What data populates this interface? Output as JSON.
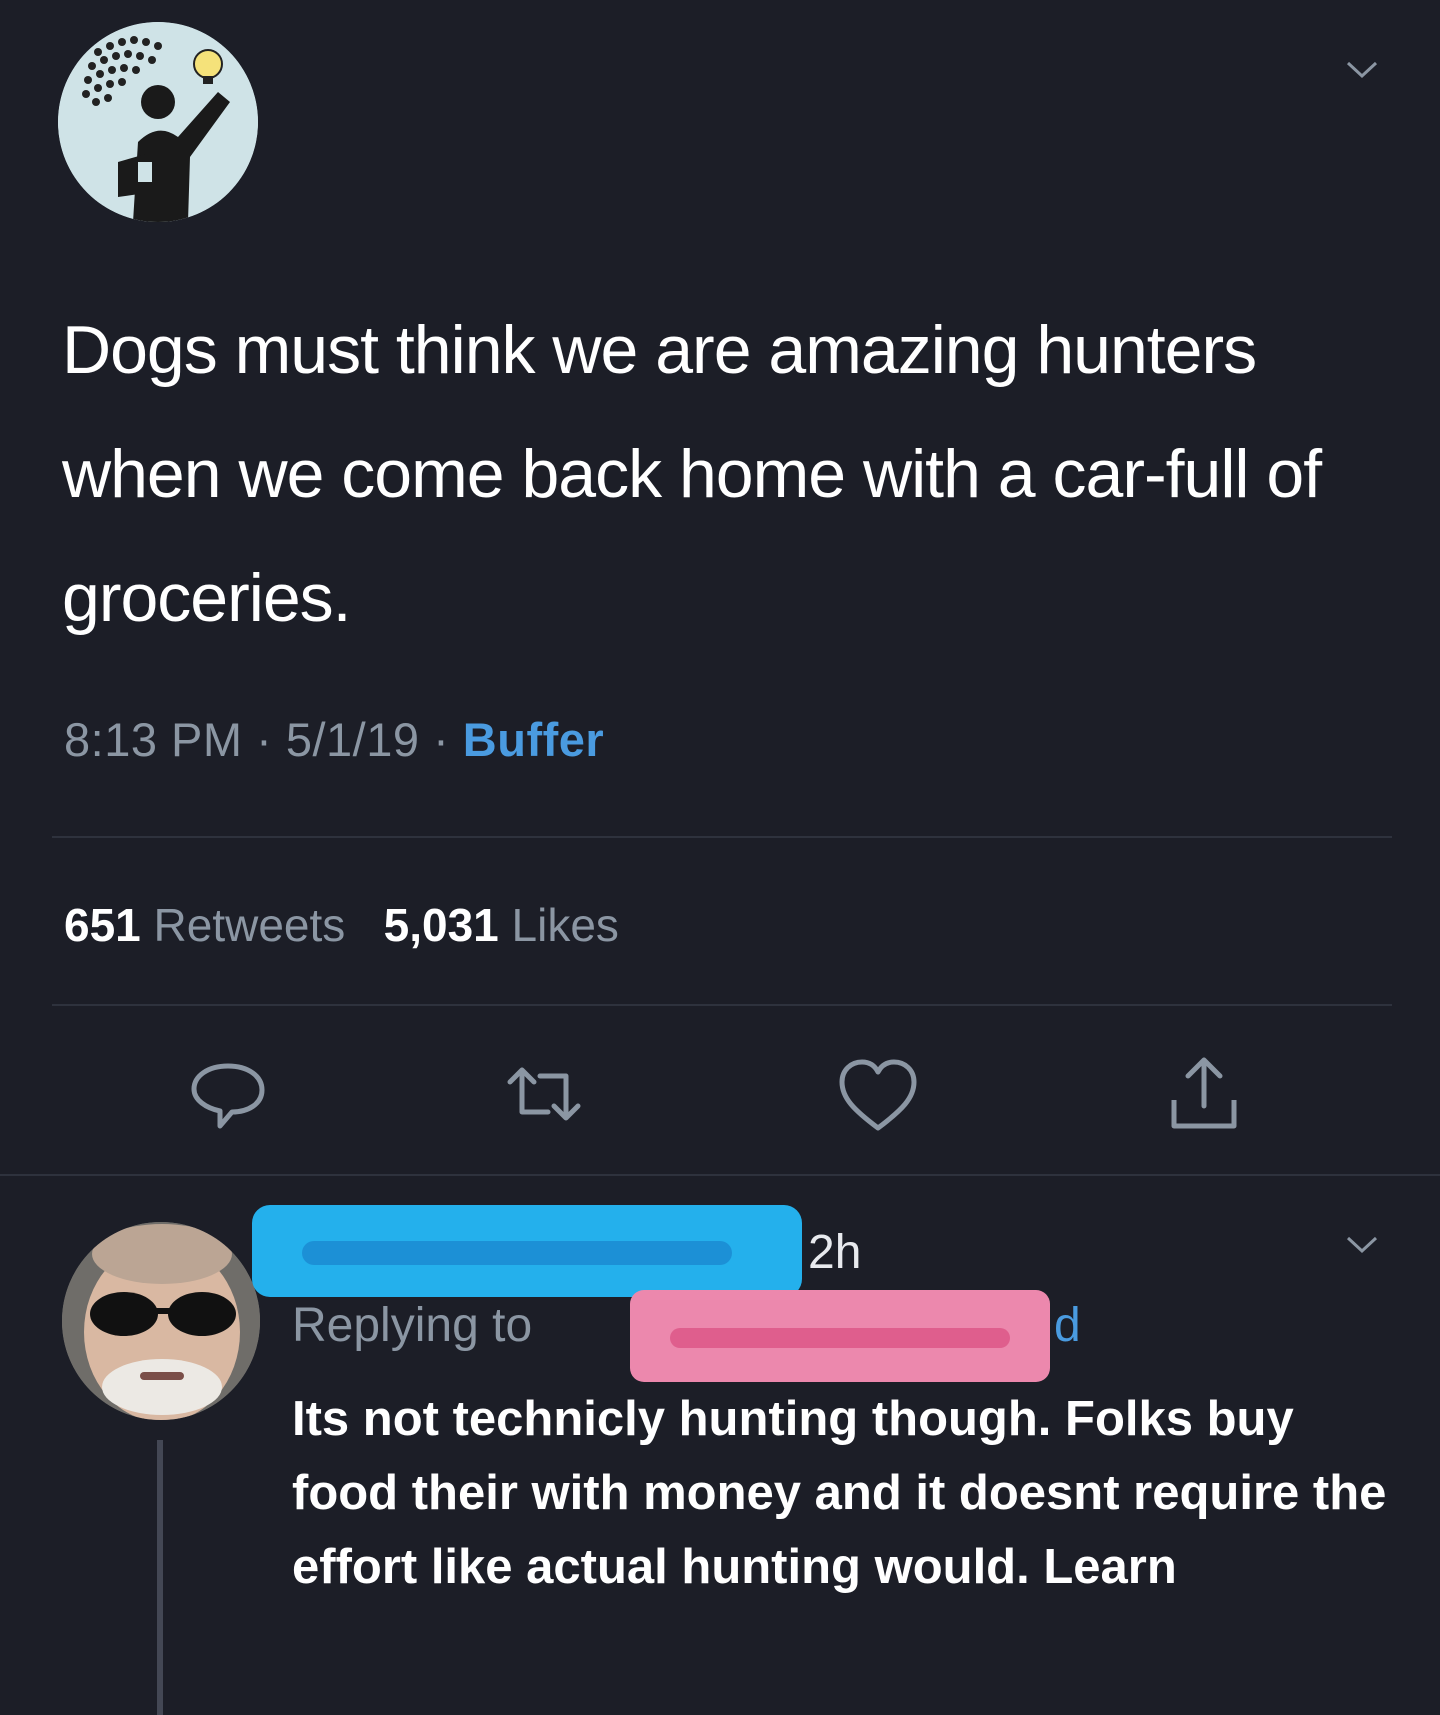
{
  "tweet": {
    "text": "Dogs must think we are amazing hunters when we come back home with a car-full of groceries.",
    "time": "8:13 PM",
    "separator": "·",
    "date": "5/1/19",
    "source": "Buffer",
    "retweets_count": "651",
    "retweets_label": "Retweets",
    "likes_count": "5,031",
    "likes_label": "Likes"
  },
  "icons": {
    "reply": "reply-icon",
    "retweet": "retweet-icon",
    "like": "heart-icon",
    "share": "share-icon",
    "menu": "chevron-down-icon"
  },
  "reply": {
    "time": "2h",
    "replying_prefix": "Replying to",
    "replying_suffix": "d",
    "text": "Its not technicly hunting though. Folks buy food their with money and it doesnt require the effort like actual hunting would. Learn"
  },
  "colors": {
    "background": "#1c1e27",
    "secondary_text": "#8b96a3",
    "link": "#4a9be0",
    "redaction_blue": "#24b0ec",
    "redaction_pink": "#ec88ad"
  }
}
